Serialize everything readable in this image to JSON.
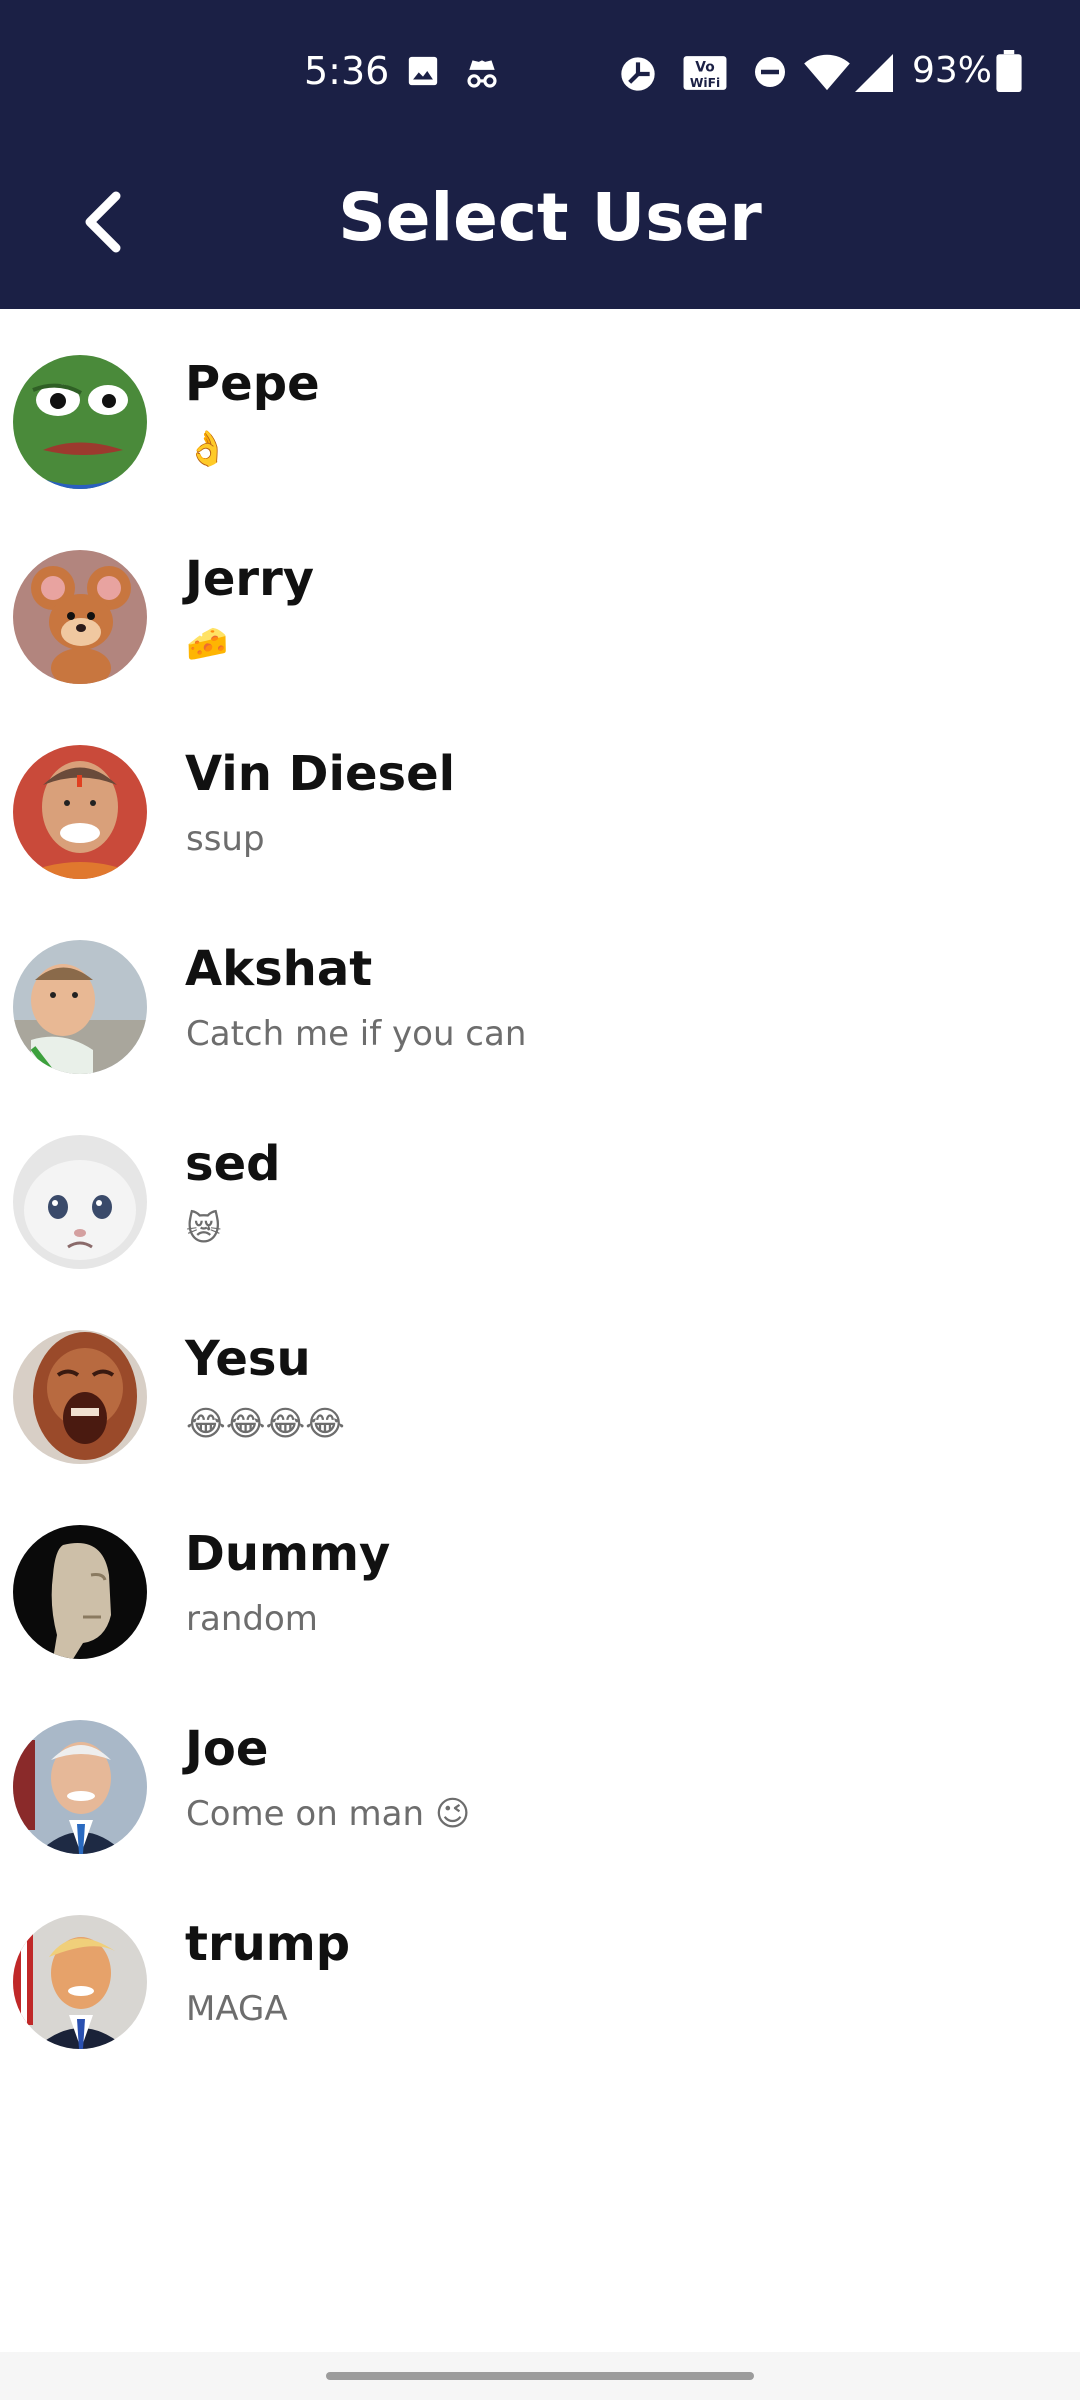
{
  "status_bar": {
    "time": "5:36",
    "battery": "93%",
    "icons": [
      "image-icon",
      "incognito-icon",
      "data-saver-icon",
      "vowifi-icon",
      "dnd-icon",
      "wifi-icon",
      "signal-icon",
      "battery-icon"
    ]
  },
  "app_bar": {
    "title": "Select User",
    "back_icon": "back-arrow-icon"
  },
  "users": [
    {
      "name": "Pepe",
      "status": "👌"
    },
    {
      "name": "Jerry",
      "status": "🧀"
    },
    {
      "name": "Vin Diesel",
      "status": "ssup"
    },
    {
      "name": "Akshat",
      "status": "Catch me if you can"
    },
    {
      "name": "sed",
      "status": "😿"
    },
    {
      "name": "Yesu",
      "status": "😂😂😂😂"
    },
    {
      "name": "Dummy",
      "status": "random"
    },
    {
      "name": "Joe",
      "status": "Come on man 😉"
    },
    {
      "name": "trump",
      "status": "MAGA"
    }
  ],
  "colors": {
    "app_bar_bg": "#1b2045",
    "name_text": "#111111",
    "status_text": "#6d6d6d"
  }
}
